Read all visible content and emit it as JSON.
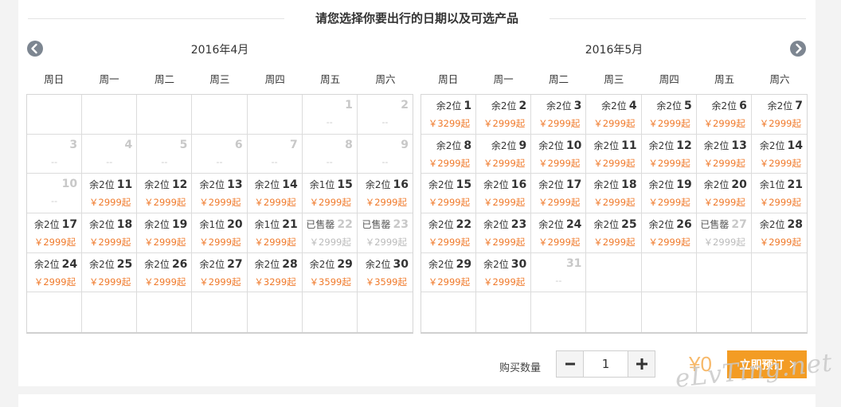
{
  "header": {
    "title": "请您选择你要出行的日期以及可选产品"
  },
  "weekdays": [
    "周日",
    "周一",
    "周二",
    "周三",
    "周四",
    "周五",
    "周六"
  ],
  "calendars": [
    {
      "title": "2016年4月",
      "cells": [
        {
          "type": "empty"
        },
        {
          "type": "empty"
        },
        {
          "type": "empty"
        },
        {
          "type": "empty"
        },
        {
          "type": "empty"
        },
        {
          "type": "na",
          "day": "1",
          "price": "--"
        },
        {
          "type": "na",
          "day": "2",
          "price": "--"
        },
        {
          "type": "na",
          "day": "3",
          "price": "--"
        },
        {
          "type": "na",
          "day": "4",
          "price": "--"
        },
        {
          "type": "na",
          "day": "5",
          "price": "--"
        },
        {
          "type": "na",
          "day": "6",
          "price": "--"
        },
        {
          "type": "na",
          "day": "7",
          "price": "--"
        },
        {
          "type": "na",
          "day": "8",
          "price": "--"
        },
        {
          "type": "na",
          "day": "9",
          "price": "--"
        },
        {
          "type": "na",
          "day": "10",
          "price": "--"
        },
        {
          "type": "avail",
          "status": "余2位",
          "day": "11",
          "price": "￥2999起"
        },
        {
          "type": "avail",
          "status": "余2位",
          "day": "12",
          "price": "￥2999起"
        },
        {
          "type": "avail",
          "status": "余2位",
          "day": "13",
          "price": "￥2999起"
        },
        {
          "type": "avail",
          "status": "余2位",
          "day": "14",
          "price": "￥2999起"
        },
        {
          "type": "avail",
          "status": "余1位",
          "day": "15",
          "price": "￥2999起"
        },
        {
          "type": "avail",
          "status": "余2位",
          "day": "16",
          "price": "￥2999起"
        },
        {
          "type": "avail",
          "status": "余2位",
          "day": "17",
          "price": "￥2999起"
        },
        {
          "type": "avail",
          "status": "余2位",
          "day": "18",
          "price": "￥2999起"
        },
        {
          "type": "avail",
          "status": "余2位",
          "day": "19",
          "price": "￥2999起"
        },
        {
          "type": "avail",
          "status": "余1位",
          "day": "20",
          "price": "￥2999起"
        },
        {
          "type": "avail",
          "status": "余1位",
          "day": "21",
          "price": "￥2999起"
        },
        {
          "type": "sold",
          "status": "已售罄",
          "day": "22",
          "price": "￥2999起"
        },
        {
          "type": "sold",
          "status": "已售罄",
          "day": "23",
          "price": "￥2999起"
        },
        {
          "type": "avail",
          "status": "余2位",
          "day": "24",
          "price": "￥2999起"
        },
        {
          "type": "avail",
          "status": "余2位",
          "day": "25",
          "price": "￥2999起"
        },
        {
          "type": "avail",
          "status": "余2位",
          "day": "26",
          "price": "￥2999起"
        },
        {
          "type": "avail",
          "status": "余2位",
          "day": "27",
          "price": "￥2999起"
        },
        {
          "type": "avail",
          "status": "余2位",
          "day": "28",
          "price": "￥3299起"
        },
        {
          "type": "avail",
          "status": "余2位",
          "day": "29",
          "price": "￥3599起"
        },
        {
          "type": "avail",
          "status": "余2位",
          "day": "30",
          "price": "￥3599起"
        },
        {
          "type": "empty"
        },
        {
          "type": "empty"
        },
        {
          "type": "empty"
        },
        {
          "type": "empty"
        },
        {
          "type": "empty"
        },
        {
          "type": "empty"
        },
        {
          "type": "empty"
        }
      ]
    },
    {
      "title": "2016年5月",
      "cells": [
        {
          "type": "avail",
          "status": "余2位",
          "day": "1",
          "price": "￥3299起"
        },
        {
          "type": "avail",
          "status": "余2位",
          "day": "2",
          "price": "￥2999起"
        },
        {
          "type": "avail",
          "status": "余2位",
          "day": "3",
          "price": "￥2999起"
        },
        {
          "type": "avail",
          "status": "余2位",
          "day": "4",
          "price": "￥2999起"
        },
        {
          "type": "avail",
          "status": "余2位",
          "day": "5",
          "price": "￥2999起"
        },
        {
          "type": "avail",
          "status": "余2位",
          "day": "6",
          "price": "￥2999起"
        },
        {
          "type": "avail",
          "status": "余2位",
          "day": "7",
          "price": "￥2999起"
        },
        {
          "type": "avail",
          "status": "余2位",
          "day": "8",
          "price": "￥2999起"
        },
        {
          "type": "avail",
          "status": "余2位",
          "day": "9",
          "price": "￥2999起"
        },
        {
          "type": "avail",
          "status": "余2位",
          "day": "10",
          "price": "￥2999起"
        },
        {
          "type": "avail",
          "status": "余2位",
          "day": "11",
          "price": "￥2999起"
        },
        {
          "type": "avail",
          "status": "余2位",
          "day": "12",
          "price": "￥2999起"
        },
        {
          "type": "avail",
          "status": "余2位",
          "day": "13",
          "price": "￥2999起"
        },
        {
          "type": "avail",
          "status": "余2位",
          "day": "14",
          "price": "￥2999起"
        },
        {
          "type": "avail",
          "status": "余2位",
          "day": "15",
          "price": "￥2999起"
        },
        {
          "type": "avail",
          "status": "余2位",
          "day": "16",
          "price": "￥2999起"
        },
        {
          "type": "avail",
          "status": "余2位",
          "day": "17",
          "price": "￥2999起"
        },
        {
          "type": "avail",
          "status": "余2位",
          "day": "18",
          "price": "￥2999起"
        },
        {
          "type": "avail",
          "status": "余2位",
          "day": "19",
          "price": "￥2999起"
        },
        {
          "type": "avail",
          "status": "余2位",
          "day": "20",
          "price": "￥2999起"
        },
        {
          "type": "avail",
          "status": "余1位",
          "day": "21",
          "price": "￥2999起"
        },
        {
          "type": "avail",
          "status": "余2位",
          "day": "22",
          "price": "￥2999起"
        },
        {
          "type": "avail",
          "status": "余2位",
          "day": "23",
          "price": "￥2999起"
        },
        {
          "type": "avail",
          "status": "余2位",
          "day": "24",
          "price": "￥2999起"
        },
        {
          "type": "avail",
          "status": "余2位",
          "day": "25",
          "price": "￥2999起"
        },
        {
          "type": "avail",
          "status": "余2位",
          "day": "26",
          "price": "￥2999起"
        },
        {
          "type": "sold",
          "status": "已售罄",
          "day": "27",
          "price": "￥2999起"
        },
        {
          "type": "avail",
          "status": "余2位",
          "day": "28",
          "price": "￥2999起"
        },
        {
          "type": "avail",
          "status": "余2位",
          "day": "29",
          "price": "￥2999起"
        },
        {
          "type": "avail",
          "status": "余2位",
          "day": "30",
          "price": "￥2999起"
        },
        {
          "type": "na",
          "day": "31",
          "price": "--"
        },
        {
          "type": "empty"
        },
        {
          "type": "empty"
        },
        {
          "type": "empty"
        },
        {
          "type": "empty"
        },
        {
          "type": "empty"
        },
        {
          "type": "empty"
        },
        {
          "type": "empty"
        },
        {
          "type": "empty"
        },
        {
          "type": "empty"
        },
        {
          "type": "empty"
        },
        {
          "type": "empty"
        }
      ]
    }
  ],
  "purchase": {
    "quantity_label": "购买数量",
    "quantity_value": "1",
    "total": "¥0",
    "book_label": "立即预订"
  },
  "watermark": "eLvTing.net",
  "colors": {
    "price": "#f07a2b",
    "book": "#f39c24",
    "nav": "#7d8691"
  },
  "icons": {
    "prev": "chevron-left-icon",
    "next": "chevron-right-icon",
    "minus": "minus-icon",
    "plus": "plus-icon"
  }
}
